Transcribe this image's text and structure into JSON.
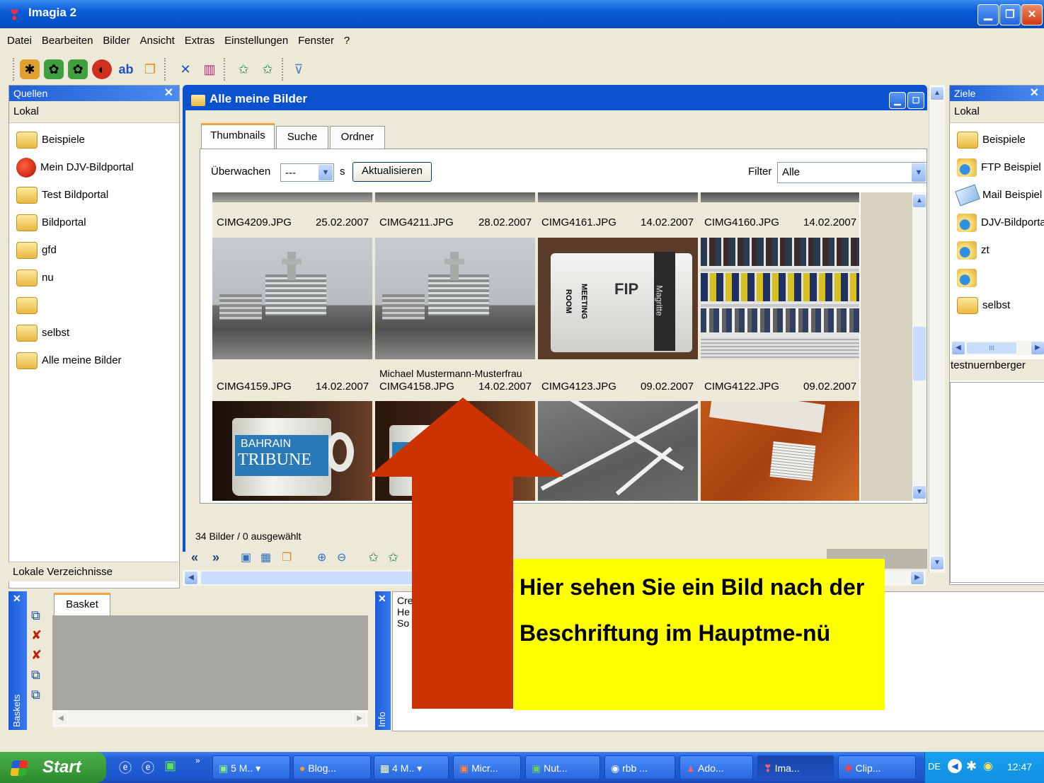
{
  "app": {
    "title": "Imagia 2"
  },
  "menu": [
    "Datei",
    "Bearbeiten",
    "Bilder",
    "Ansicht",
    "Extras",
    "Einstellungen",
    "Fenster",
    "?"
  ],
  "sources": {
    "header": "Quellen",
    "location": "Lokal",
    "items": [
      "Beispiele",
      "Mein DJV-Bildportal",
      "Test Bildportal",
      "Bildportal",
      "gfd",
      "nu",
      "",
      "selbst",
      "Alle meine Bilder"
    ],
    "footer": "Lokale Verzeichnisse"
  },
  "targets": {
    "header": "Ziele",
    "location": "Lokal",
    "items": [
      "Beispiele",
      "FTP Beispiel",
      "Mail Beispiel",
      "DJV-Bildportal",
      "zt",
      "",
      "selbst"
    ],
    "scroll_label": "III",
    "selected": "testnuernberger"
  },
  "window": {
    "title": "Alle meine Bilder",
    "tabs": [
      "Thumbnails",
      "Suche",
      "Ordner"
    ],
    "watch_label": "Überwachen",
    "watch_value": "---",
    "watch_unit": "s",
    "refresh_button": "Aktualisieren",
    "filter_label": "Filter",
    "filter_value": "Alle",
    "status": "34 Bilder / 0 ausgewählt"
  },
  "thumbnails": {
    "row1": [
      {
        "name": "CIMG4209.JPG",
        "date": "25.02.2007"
      },
      {
        "name": "CIMG4211.JPG",
        "date": "28.02.2007"
      },
      {
        "name": "CIMG4161.JPG",
        "date": "14.02.2007"
      },
      {
        "name": "CIMG4160.JPG",
        "date": "14.02.2007"
      }
    ],
    "row2": [
      {
        "name": "CIMG4159.JPG",
        "date": "14.02.2007",
        "caption": ""
      },
      {
        "name": "CIMG4158.JPG",
        "date": "14.02.2007",
        "caption": "Michael Mustermann-Musterfrau"
      },
      {
        "name": "CIMG4123.JPG",
        "date": "09.02.2007",
        "caption": ""
      },
      {
        "name": "CIMG4122.JPG",
        "date": "09.02.2007",
        "caption": ""
      }
    ]
  },
  "photo_text": {
    "meeting": "MEETING",
    "room": "ROOM",
    "fip": "FIP",
    "magritte": "Magritte",
    "mug1": "BAHRAIN",
    "mug2": "TRIBUNE"
  },
  "basket": {
    "side_label": "Baskets",
    "tab": "Basket"
  },
  "info": {
    "side_label": "Info",
    "lines": [
      "Cre",
      "He",
      "So"
    ]
  },
  "callout": {
    "text": "Hier sehen Sie ein Bild nach der Beschriftung im Hauptme-nü"
  },
  "taskbar": {
    "start": "Start",
    "tasks": [
      "5 M..",
      "Blog...",
      "4 M..",
      "Micr...",
      "Nut...",
      "rbb ...",
      "Ado...",
      "Ima...",
      "Clip..."
    ],
    "lang": "DE",
    "clock": "12:47"
  },
  "colors": {
    "arrow": "#cc3300",
    "callout": "#ffff00",
    "titlebar": "#0a5ad8"
  }
}
